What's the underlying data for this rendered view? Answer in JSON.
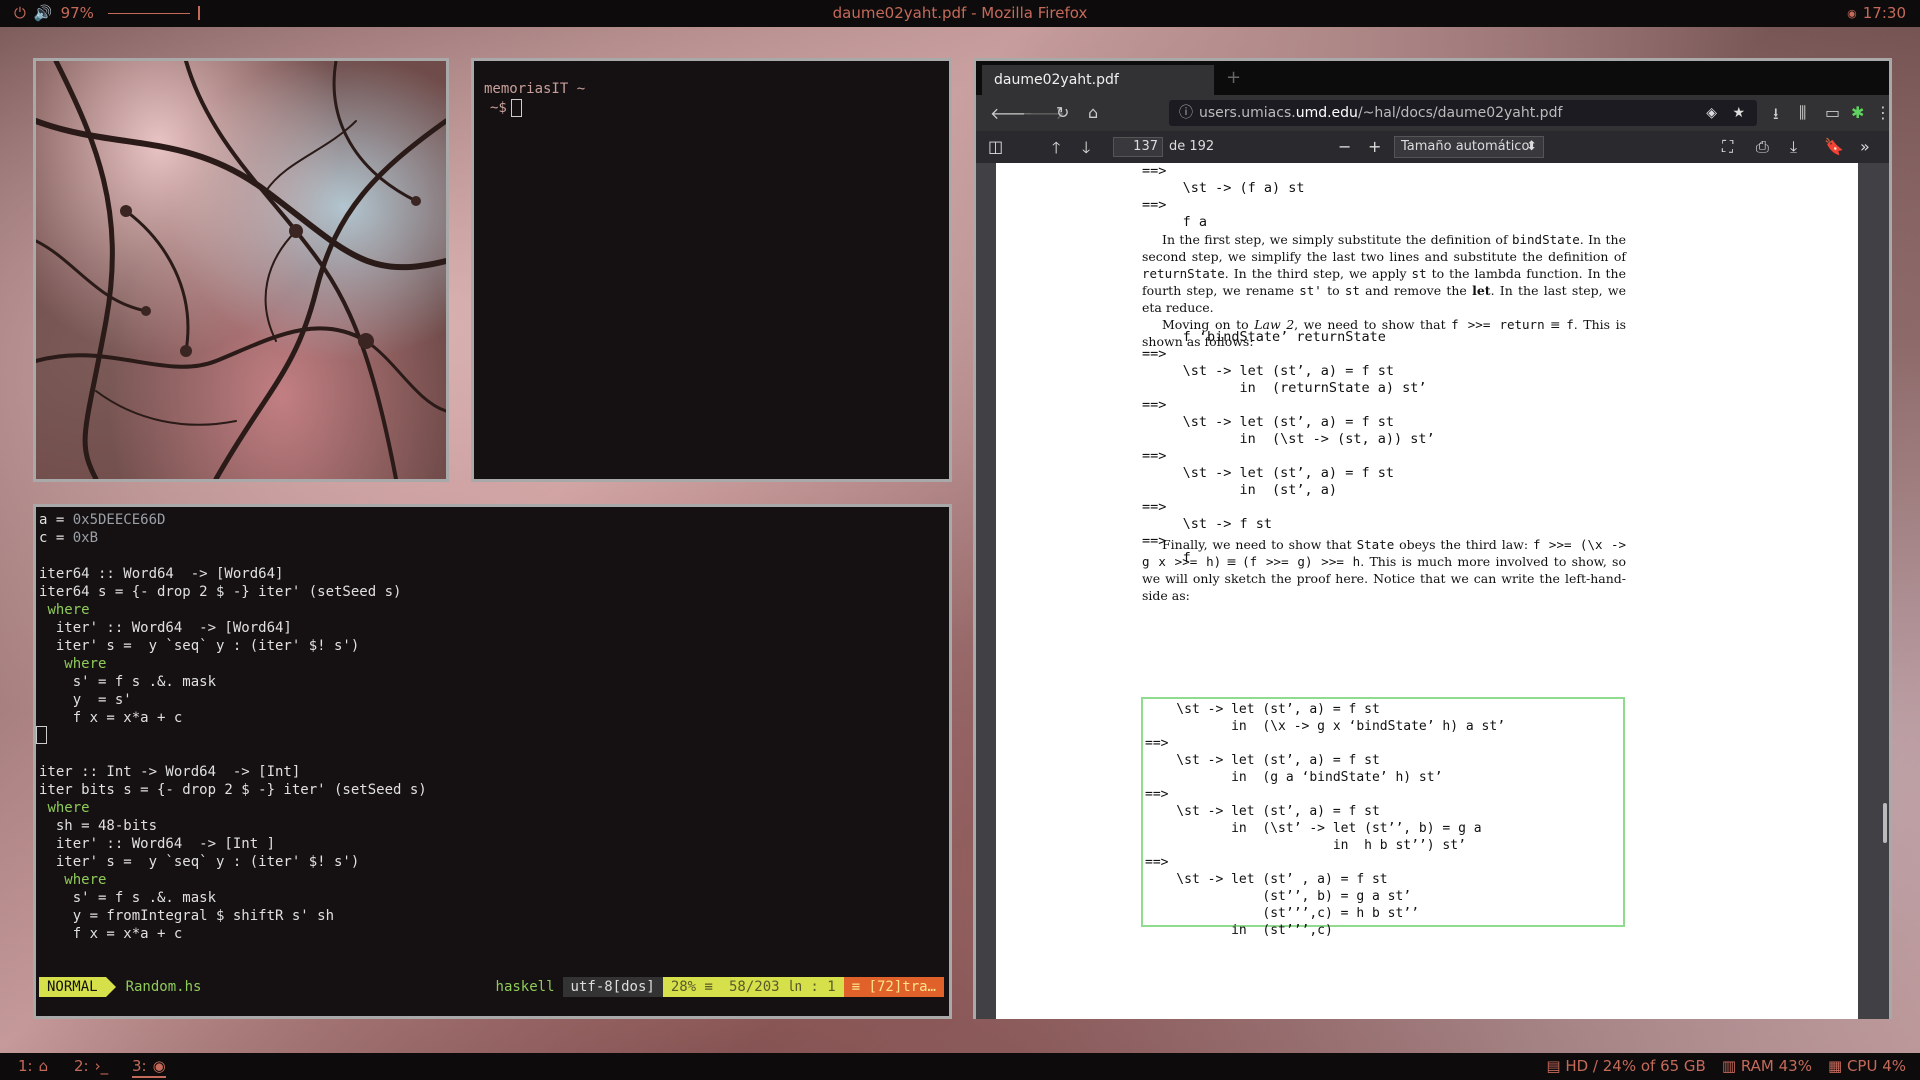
{
  "topbar": {
    "power_icon": "power-icon",
    "volume_icon": "speaker-icon",
    "volume": "97%",
    "volume_level": 0.97,
    "window_title": "daume02yaht.pdf - Mozilla Firefox",
    "clock_icon": "clock-icon",
    "time": "17:30"
  },
  "terminal": {
    "prompt_line": "memoriasIT ~",
    "prompt": " ~$"
  },
  "vim": {
    "code": "a = 0x5DEECE66D\nc = 0xB\n\niter64 :: Word64  -> [Word64]\niter64 s = {- drop 2 $ -} iter' (setSeed s)\n where\n  iter' :: Word64  -> [Word64]\n  iter' s =  y `seq` y : (iter' $! s')\n   where\n    s' = f s .&. mask\n    y  = s'\n    f x = x*a + c\n\n\niter :: Int -> Word64  -> [Int]\niter bits s = {- drop 2 $ -} iter' (setSeed s)\n where\n  sh = 48-bits\n  iter' :: Word64  -> [Int ]\n  iter' s =  y `seq` y : (iter' $! s')\n   where\n    s' = f s .&. mask\n    y = fromIntegral $ shiftR s' sh\n    f x = x*a + c",
    "status": {
      "mode": "NORMAL",
      "filename": "Random.hs",
      "filetype": "haskell",
      "encoding": "utf-8[dos]",
      "percent": "28% ≡",
      "position": "58/203 ㏑ :  1",
      "warning": "≡ [72]tra…"
    }
  },
  "firefox": {
    "tab_title": "daume02yaht.pdf",
    "new_tab": "+",
    "url_prefix": "users.umiacs.",
    "url_host": "umd.edu",
    "url_path": "/~hal/docs/daume02yaht.pdf",
    "pdf": {
      "page_number": "137",
      "page_of": "de 192",
      "zoom": "Tamaño automático",
      "code_top": "==>\n     \\st -> (f a) st\n==>\n     f a",
      "para1_a": "In the first step, we simply substitute the definition of ",
      "para1_b": "bindState",
      "para1_c": ". In the second step, we simplify the last two lines and substitute the definition of ",
      "para1_d": "returnState",
      "para1_e": ". In the third step, we apply ",
      "para1_f": "st",
      "para1_g": " to the lambda function. In the fourth step, we rename ",
      "para1_h": "st'",
      "para1_i": " to ",
      "para1_j": "st",
      "para1_k": " and remove the ",
      "para1_l": "let",
      "para1_m": ". In the last step, we eta reduce.",
      "para2_a": "Moving on to ",
      "para2_b": "Law 2",
      "para2_c": ", we need to show that ",
      "para2_d": "f >>= return",
      "para2_e": " ≡ ",
      "para2_f": "f",
      "para2_g": ". This is shown as follows:",
      "code_mid": "     f ‘bindState’ returnState\n==>\n     \\st -> let (st’, a) = f st\n            in  (returnState a) st’\n==>\n     \\st -> let (st’, a) = f st\n            in  (\\st -> (st, a)) st’\n==>\n     \\st -> let (st’, a) = f st\n            in  (st’, a)\n==>\n     \\st -> f st\n==>\n     f",
      "para3_a": "Finally, we need to show that ",
      "para3_b": "State",
      "para3_c": " obeys the third law: ",
      "para3_d": "f >>= (\\x -> g x >>= h)",
      "para3_e": " ≡ ",
      "para3_f": "(f >>= g) >>= h",
      "para3_g": ". This is much more involved to show, so we will only sketch the proof here. Notice that we can write the left-hand-side as:",
      "code_box": "    \\st -> let (st’, a) = f st\n           in  (\\x -> g x ‘bindState’ h) a st’\n==>\n    \\st -> let (st’, a) = f st\n           in  (g a ‘bindState’ h) st’\n==>\n    \\st -> let (st’, a) = f st\n           in  (\\st’ -> let (st’’, b) = g a\n                        in  h b st’’) st’\n==>\n    \\st -> let (st’ , a) = f st\n               (st’’, b) = g a st’\n               (st’’’,c) = h b st’’\n           in  (st’’’,c)"
    }
  },
  "bottombar": {
    "ws1": "1:",
    "ws1_icon": "home-icon",
    "ws2": "2:",
    "ws2_icon": "terminal-icon",
    "ws3": "3:",
    "ws3_icon": "firefox-icon",
    "disk": "HD / 24% of 65 GB",
    "ram": "RAM 43%",
    "cpu": "CPU  4%"
  }
}
